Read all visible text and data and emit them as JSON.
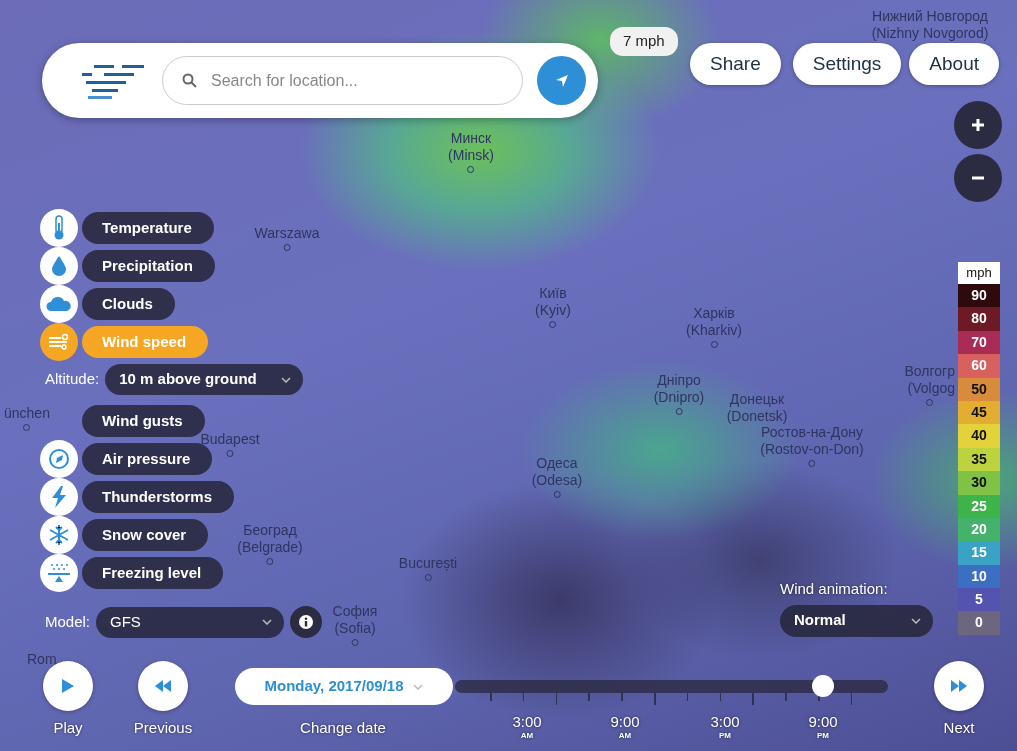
{
  "header": {
    "search": {
      "placeholder": "Search for location..."
    }
  },
  "speed_badge": "7 mph",
  "top_buttons": [
    "Share",
    "Settings",
    "About"
  ],
  "map": {
    "labels": [
      {
        "lines": [
          "Нижний Новгород",
          "(Nizhny Novgorod)"
        ]
      },
      {
        "lines": [
          "Минск",
          "(Minsk)"
        ]
      },
      {
        "lines": [
          "Warszawa"
        ]
      },
      {
        "lines": [
          "Київ",
          "(Kyiv)"
        ]
      },
      {
        "lines": [
          "Харків",
          "(Kharkiv)"
        ]
      },
      {
        "lines": [
          "Дніпро",
          "(Dnipro)"
        ]
      },
      {
        "lines": [
          "Донецьк",
          "(Donetsk)"
        ]
      },
      {
        "lines": [
          "Ростов-на-Дону",
          "(Rostov-on-Don)"
        ]
      },
      {
        "lines": [
          "Одеса",
          "(Odesa)"
        ]
      },
      {
        "lines": [
          "Budapest"
        ]
      },
      {
        "lines": [
          "Београд",
          "(Belgrade)"
        ]
      },
      {
        "lines": [
          "București"
        ]
      },
      {
        "lines": [
          "София",
          "(Sofia)"
        ]
      },
      {
        "lines": [
          "ünchen"
        ]
      },
      {
        "lines": [
          "Rom"
        ]
      },
      {
        "lines": [
          "Волгогр",
          "(Volgog"
        ]
      }
    ]
  },
  "layers": [
    {
      "label": "Temperature",
      "selected": false
    },
    {
      "label": "Precipitation",
      "selected": false
    },
    {
      "label": "Clouds",
      "selected": false
    },
    {
      "label": "Wind speed",
      "selected": true
    },
    {
      "label": "Wind gusts",
      "selected": false
    },
    {
      "label": "Air pressure",
      "selected": false
    },
    {
      "label": "Thunderstorms",
      "selected": false
    },
    {
      "label": "Snow cover",
      "selected": false
    },
    {
      "label": "Freezing level",
      "selected": false
    }
  ],
  "altitude": {
    "label": "Altitude:",
    "value": "10 m above ground"
  },
  "model": {
    "label": "Model:",
    "value": "GFS"
  },
  "wind_animation": {
    "label": "Wind animation:",
    "value": "Normal"
  },
  "legend": {
    "unit": "mph",
    "steps": [
      {
        "value": "90",
        "color": "#2e0a0c"
      },
      {
        "value": "80",
        "color": "#6e1a26"
      },
      {
        "value": "70",
        "color": "#a82c55"
      },
      {
        "value": "60",
        "color": "#d8605f"
      },
      {
        "value": "50",
        "color": "#d98b3c"
      },
      {
        "value": "45",
        "color": "#e2ad30"
      },
      {
        "value": "40",
        "color": "#e3d23a"
      },
      {
        "value": "35",
        "color": "#bcd23e"
      },
      {
        "value": "30",
        "color": "#7fc246"
      },
      {
        "value": "25",
        "color": "#3db449"
      },
      {
        "value": "20",
        "color": "#45b26c"
      },
      {
        "value": "15",
        "color": "#3aa2c4"
      },
      {
        "value": "10",
        "color": "#3b6fc2"
      },
      {
        "value": "5",
        "color": "#5453b0"
      },
      {
        "value": "0",
        "color": "#6d667f"
      }
    ]
  },
  "timeline": {
    "date": "Monday, 2017/09/18",
    "level": 0.85,
    "ticks": [
      {
        "time": "3:00",
        "period": "AM"
      },
      {
        "time": "9:00",
        "period": "AM"
      },
      {
        "time": "3:00",
        "period": "PM"
      },
      {
        "time": "9:00",
        "period": "PM"
      }
    ]
  },
  "controls": {
    "play": "Play",
    "previous": "Previous",
    "change_date": "Change date",
    "next": "Next"
  }
}
